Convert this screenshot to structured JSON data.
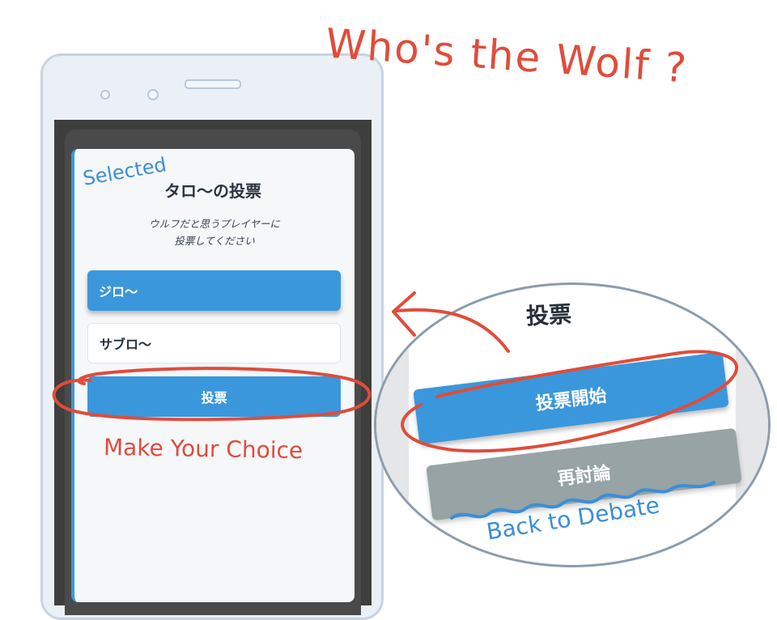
{
  "vote_screen": {
    "title": "タロ〜の投票",
    "subtitle_line1": "ウルフだと思うプレイヤーに",
    "subtitle_line2": "投票してください",
    "options": [
      {
        "label": "ジロ〜",
        "selected": true
      },
      {
        "label": "サブロ〜",
        "selected": false
      }
    ],
    "vote_button": "投票"
  },
  "zoom_panel": {
    "title": "投票",
    "start_button": "投票開始",
    "rediscuss_button": "再討論"
  },
  "annotations": {
    "title": "Who's the Wolf ?",
    "selected": "Selected",
    "make_choice": "Make Your Choice",
    "back_to_debate": "Back to Debate"
  },
  "colors": {
    "primary_blue": "#3b97db",
    "annotation_red": "#e04c3b",
    "annotation_blue": "#3b8fd6",
    "gray_button": "#97a3a4"
  }
}
